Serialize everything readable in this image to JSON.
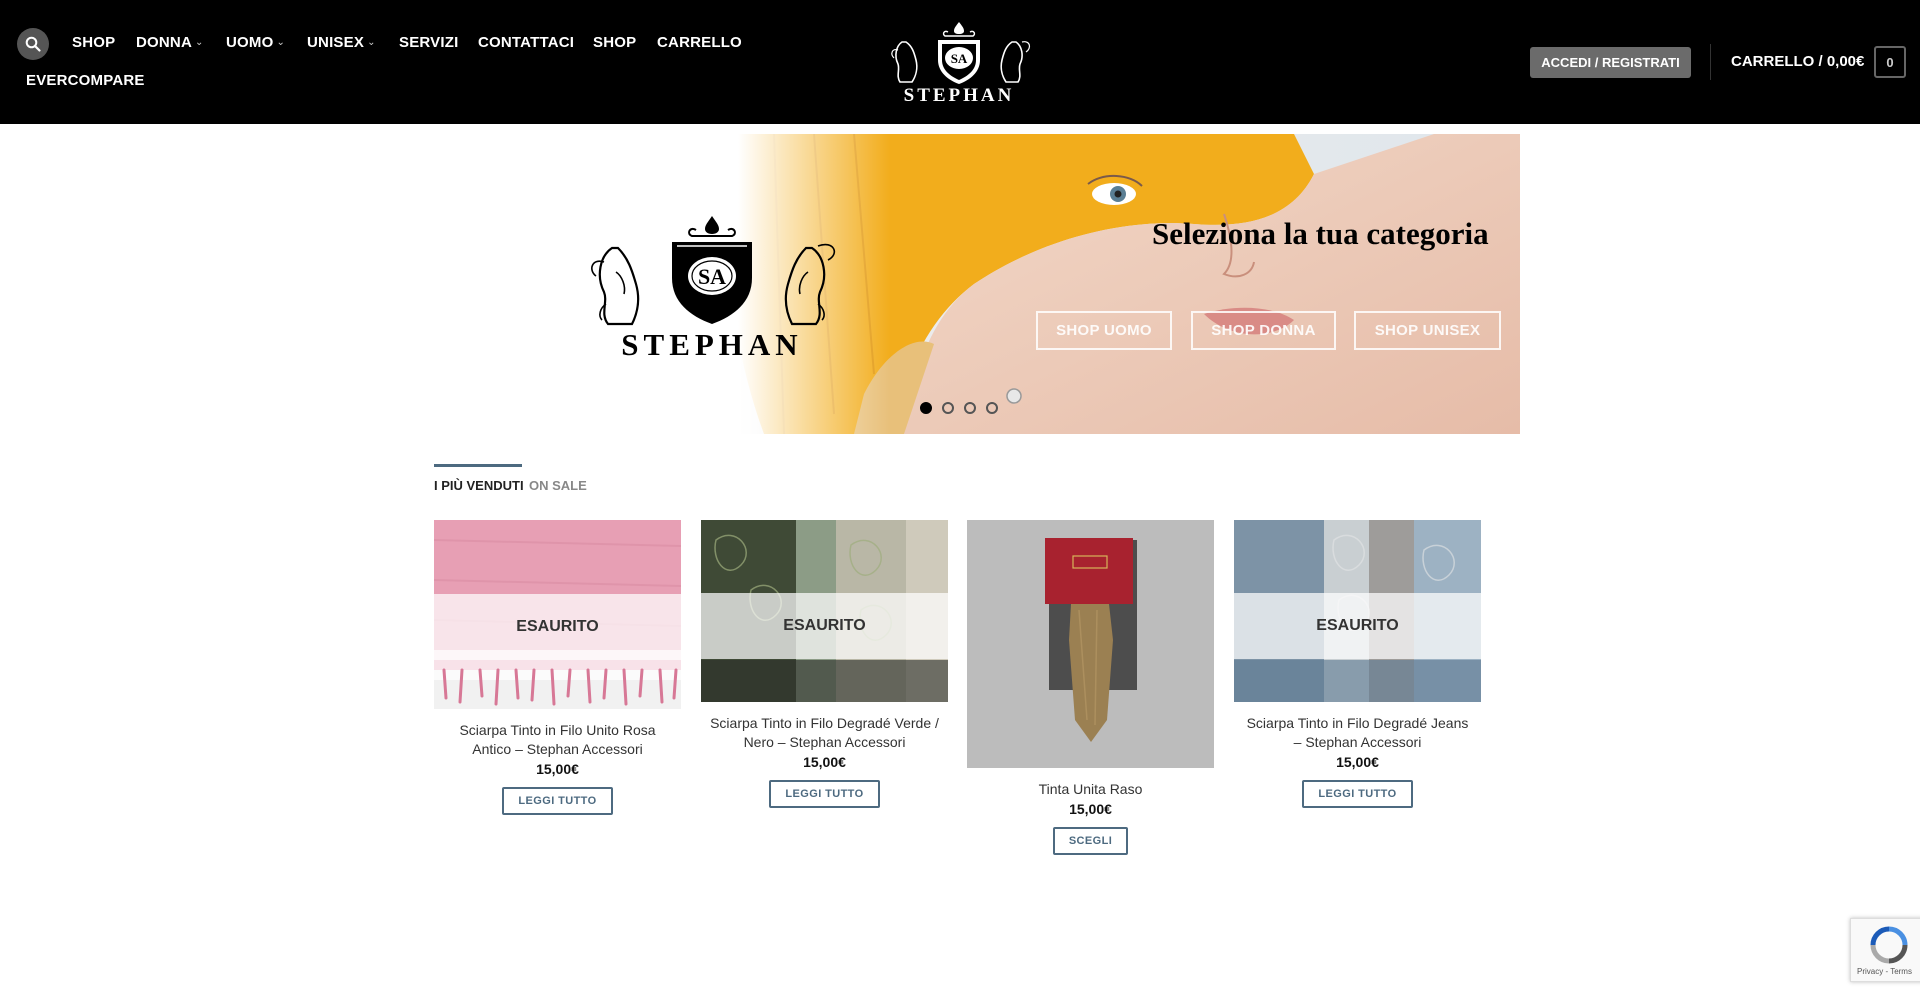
{
  "header": {
    "nav": [
      {
        "label": "SHOP",
        "has_caret": false
      },
      {
        "label": "DONNA",
        "has_caret": true
      },
      {
        "label": "UOMO",
        "has_caret": true
      },
      {
        "label": "UNISEX",
        "has_caret": true
      },
      {
        "label": "SERVIZI",
        "has_caret": false
      },
      {
        "label": "CONTATTACI",
        "has_caret": false
      },
      {
        "label": "SHOP",
        "has_caret": false
      },
      {
        "label": "CARRELLO",
        "has_caret": false
      },
      {
        "label": "EVERCOMPARE",
        "has_caret": false
      }
    ],
    "logo_monogram": "SA",
    "logo_text": "STEPHAN",
    "login_label": "ACCEDI / REGISTRATI",
    "cart_label": "CARRELLO / 0,00€",
    "cart_count": "0",
    "caret_char": "⌵"
  },
  "hero": {
    "logo_monogram": "SA",
    "logo_text": "STEPHAN",
    "title": "Seleziona la tua categoria",
    "buttons": [
      "SHOP UOMO",
      "SHOP DONNA",
      "SHOP UNISEX"
    ],
    "slide_count": 4,
    "active_slide": 1
  },
  "tabs": [
    {
      "label": "I PIÙ VENDUTI",
      "active": true
    },
    {
      "label": "ON SALE",
      "active": false
    }
  ],
  "products": [
    {
      "name": "Sciarpa Tinto in Filo Unito Rosa Antico – Stephan Accessori",
      "price": "15,00€",
      "button": "LEGGI TUTTO",
      "badge": "ESAURITO",
      "image": "pink-scarf"
    },
    {
      "name": "Sciarpa Tinto in Filo Degradé Verde / Nero – Stephan Accessori",
      "price": "15,00€",
      "button": "LEGGI TUTTO",
      "badge": "ESAURITO",
      "image": "green-paisley-scarf"
    },
    {
      "name": "Tinta Unita Raso",
      "price": "15,00€",
      "button": "SCEGLI",
      "badge": "",
      "image": "gold-tie-box"
    },
    {
      "name": "Sciarpa Tinto in Filo Degradé Jeans – Stephan Accessori",
      "price": "15,00€",
      "button": "LEGGI TUTTO",
      "badge": "ESAURITO",
      "image": "blue-paisley-scarf"
    }
  ],
  "recaptcha": {
    "text": "Privacy - Terms"
  },
  "icons": {
    "search": "search-icon",
    "recaptcha": "recaptcha-icon"
  }
}
